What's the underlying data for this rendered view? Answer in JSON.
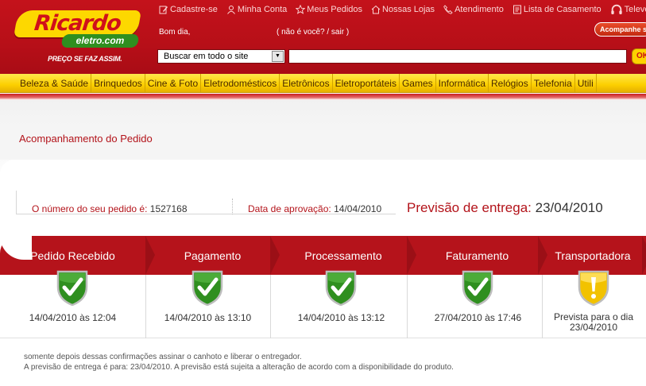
{
  "brand": {
    "name_main": "Ricardo",
    "name_sub": "eletro.com",
    "slogan": "PREÇO SE FAZ ASSIM."
  },
  "topnav": [
    {
      "label": "Cadastre-se",
      "icon": "edit-icon"
    },
    {
      "label": "Minha Conta",
      "icon": "user-icon"
    },
    {
      "label": "Meus Pedidos",
      "icon": "star-icon"
    },
    {
      "label": "Nossas Lojas",
      "icon": "home-icon"
    },
    {
      "label": "Atendimento",
      "icon": "phone-icon"
    },
    {
      "label": "Lista de Casamento",
      "icon": "list-icon"
    },
    {
      "label": "Televen",
      "icon": "headset-icon"
    }
  ],
  "user": {
    "greeting": "Bom dia,",
    "logout": "( não é você? / sair )",
    "track_button": "Acompanhe s"
  },
  "search": {
    "scope": "Buscar em todo o site",
    "value": "",
    "button": "OK"
  },
  "categories": [
    "Beleza & Saúde",
    "Brinquedos",
    "Cine & Foto",
    "Eletrodomésticos",
    "Eletrônicos",
    "Eletroportáteis",
    "Games",
    "Informática",
    "Relógios",
    "Telefonia",
    "Utili"
  ],
  "page_title": "Acompanhamento do Pedido",
  "order": {
    "number_label": "O número do seu pedido é:",
    "number": "1527168",
    "approval_label": "Data de aprovação:",
    "approval_date": "14/04/2010",
    "forecast_label": "Previsão de entrega:",
    "forecast_date": "23/04/2010"
  },
  "steps": [
    {
      "label": "Pedido Recebido",
      "date": "14/04/2010 às 12:04",
      "status": "done"
    },
    {
      "label": "Pagamento",
      "date": "14/04/2010 às 13:10",
      "status": "done"
    },
    {
      "label": "Processamento",
      "date": "14/04/2010 às 13:12",
      "status": "done"
    },
    {
      "label": "Faturamento",
      "date": "27/04/2010 às 17:46",
      "status": "done"
    },
    {
      "label": "Transportadora",
      "date": "Prevista para o dia 23/04/2010",
      "status": "pending"
    }
  ],
  "notes": {
    "line1": "somente depois dessas confirmações assinar o canhoto e liberar o entregador.",
    "line2": "A previsão de entrega é para: 23/04/2010. A previsão está sujeita a alteração de acordo com a disponibilidade do produto."
  },
  "colors": {
    "brand_red": "#b5131b",
    "brand_yellow": "#fdd800",
    "check_green": "#2f8f1f",
    "warn_yellow": "#f2c200"
  }
}
